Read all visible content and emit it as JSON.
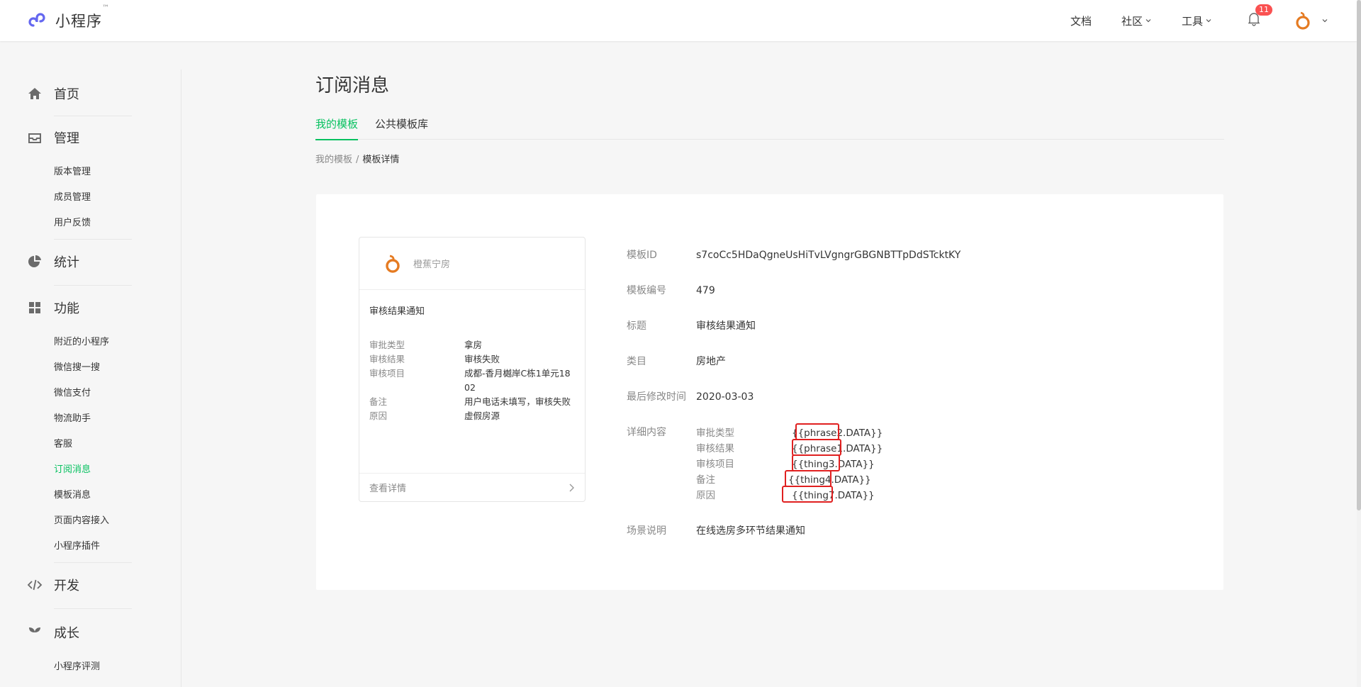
{
  "header": {
    "logo_text": "小程序",
    "logo_tm": "™",
    "nav": [
      {
        "label": "文档"
      },
      {
        "label": "社区"
      },
      {
        "label": "工具"
      }
    ],
    "notification_count": "11"
  },
  "sidebar": {
    "home": "首页",
    "manage": {
      "title": "管理",
      "items": [
        "版本管理",
        "成员管理",
        "用户反馈"
      ]
    },
    "stats": "统计",
    "features": {
      "title": "功能",
      "items": [
        "附近的小程序",
        "微信搜一搜",
        "微信支付",
        "物流助手",
        "客服",
        "订阅消息",
        "模板消息",
        "页面内容接入",
        "小程序插件"
      ]
    },
    "dev": "开发",
    "growth": {
      "title": "成长",
      "items": [
        "小程序评测"
      ]
    }
  },
  "main": {
    "title": "订阅消息",
    "tabs": [
      "我的模板",
      "公共模板库"
    ],
    "breadcrumb": {
      "parent": "我的模板",
      "sep": "/",
      "current": "模板详情"
    }
  },
  "preview": {
    "brand": "橙蕉宁房",
    "title": "审核结果通知",
    "rows": [
      {
        "k": "审批类型",
        "v": "拿房"
      },
      {
        "k": "审核结果",
        "v": "审核失败"
      },
      {
        "k": "审核项目",
        "v": "成都-香月樾岸C栋1单元1802"
      },
      {
        "k": "备注",
        "v": "用户电话未填写，审核失败"
      },
      {
        "k": "原因",
        "v": "虚假房源"
      }
    ],
    "footer": "查看详情"
  },
  "details": {
    "template_id_label": "模板ID",
    "template_id": "s7coCc5HDaQgneUsHiTvLVgngrGBGNBTTpDdSTcktKY",
    "number_label": "模板编号",
    "number": "479",
    "title_label": "标题",
    "title": "审核结果通知",
    "category_label": "类目",
    "category": "房地产",
    "modified_label": "最后修改时间",
    "modified": "2020-03-03",
    "content_label": "详细内容",
    "keywords": [
      {
        "k": "审批类型",
        "v": "{{phrase2.DATA}}"
      },
      {
        "k": "审核结果",
        "v": "{{phrase1.DATA}}"
      },
      {
        "k": "审核项目",
        "v": "{{thing3.DATA}}"
      },
      {
        "k": "备注",
        "v": "{{thing4.DATA}}"
      },
      {
        "k": "原因",
        "v": "{{thing7.DATA}}"
      }
    ],
    "scene_label": "场景说明",
    "scene": "在线选房多环节结果通知"
  },
  "colors": {
    "accent": "#07c160",
    "highlight": "#e02020",
    "badge": "#fa5151"
  }
}
